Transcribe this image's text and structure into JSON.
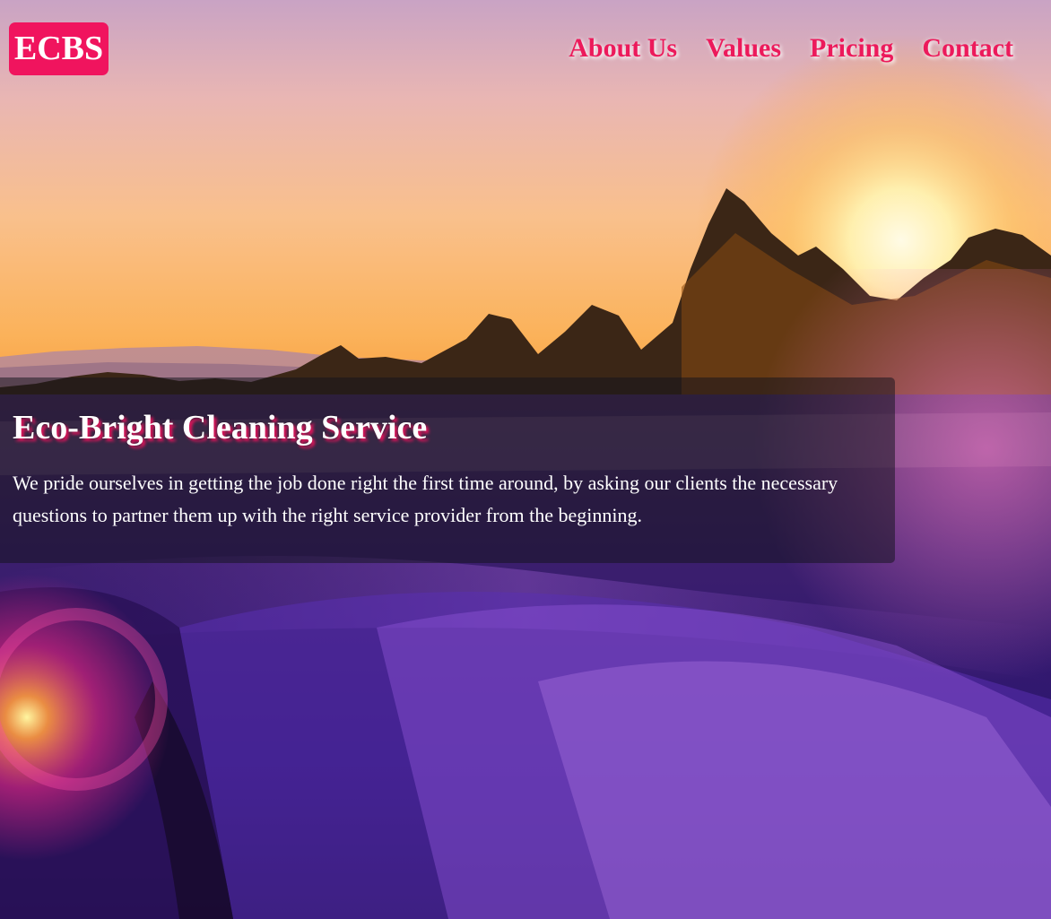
{
  "header": {
    "logo_text": "ECBS",
    "nav": [
      {
        "label": "About Us"
      },
      {
        "label": "Values"
      },
      {
        "label": "Pricing"
      },
      {
        "label": "Contact"
      }
    ]
  },
  "hero": {
    "background_image": "lavender-field-at-sunset",
    "title": "Eco-Bright Cleaning Service",
    "description": "We pride ourselves in getting the job done right the first time around, by asking our clients the necessary questions to partner them up with the right service provider from the beginning."
  },
  "colors": {
    "accent": "#f0145e",
    "nav_text": "#ec1a5b",
    "overlay": "rgba(20,20,28,0.52)",
    "text": "#ffffff"
  }
}
